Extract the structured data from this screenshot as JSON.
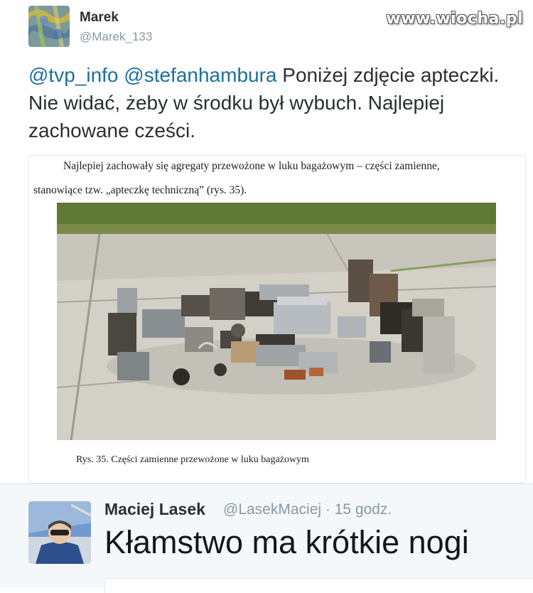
{
  "watermark": "www.wiocha.pl",
  "tweet": {
    "author_name": "Marek",
    "author_handle": "@Marek_133",
    "mention1": "@tvp_info",
    "mention2": "@stefanhambura",
    "text": "Poniżej zdjęcie apteczki. Nie widać, żeby w środku był wybuch. Najlepiej zachowane cześci."
  },
  "document": {
    "line1": "Najlepiej zachowały się agregaty przewożone w luku bagażowym – części zamienne,",
    "line2": "stanowiące tzw. „apteczkę techniczną” (rys. 35).",
    "caption": "Rys. 35. Części zamienne przewożone w luku bagażowym"
  },
  "reply": {
    "author_name": "Maciej Lasek",
    "author_handle": "@LasekMaciej",
    "separator": "·",
    "time": "15 godz.",
    "text": "Kłamstwo ma krótkie nogi"
  },
  "colors": {
    "mention": "#1b6f9f",
    "secondary_text": "#8899a6",
    "reply_background": "#f5f8fa"
  }
}
